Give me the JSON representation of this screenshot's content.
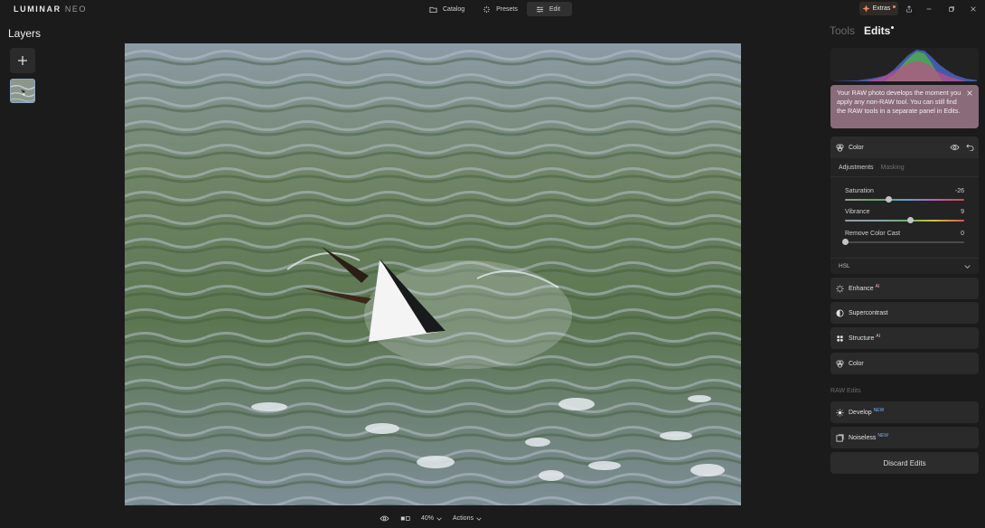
{
  "app": {
    "logo_main": "LUMINAR",
    "logo_sub": "NEO"
  },
  "nav": {
    "tabs": [
      {
        "label": "Catalog",
        "icon": "folder-icon"
      },
      {
        "label": "Presets",
        "icon": "sparkle-icon"
      },
      {
        "label": "Edit",
        "icon": "sliders-icon",
        "active": true
      }
    ]
  },
  "extras": {
    "label": "Extras",
    "icon": "extras-icon",
    "accent": "#f08a5d"
  },
  "layers": {
    "title": "Layers",
    "add_icon": "plus-icon",
    "thumb_icon": "layer-thumbnail"
  },
  "bottombar": {
    "zoom": "40%",
    "actions": "Actions",
    "eye_icon": "eye-icon",
    "compare_icon": "compare-icon"
  },
  "rightpanel": {
    "tabs": [
      {
        "label": "Tools",
        "active": false
      },
      {
        "label": "Edits",
        "active": true
      }
    ],
    "tooltip": "Your RAW photo develops the moment you apply any non-RAW tool. You can still find the RAW tools in a separate panel in Edits.",
    "tooltip_color": "#8a6b79",
    "color_tool": {
      "title": "Color",
      "subtabs": [
        {
          "label": "Adjustments",
          "active": true
        },
        {
          "label": "Masking",
          "active": false
        }
      ],
      "sliders": [
        {
          "label": "Saturation",
          "value": "-26",
          "position": 0.37
        },
        {
          "label": "Vibrance",
          "value": "9",
          "position": 0.55
        },
        {
          "label": "Remove Color Cast",
          "value": "0",
          "position": 0.0
        }
      ],
      "hsl_label": "HSL"
    },
    "edit_tools": [
      {
        "label": "Enhance",
        "icon": "enhance-icon",
        "badge": "AI"
      },
      {
        "label": "Supercontrast",
        "icon": "contrast-icon",
        "badge": ""
      },
      {
        "label": "Structure",
        "icon": "structure-icon",
        "badge": "AI"
      },
      {
        "label": "Color",
        "icon": "color-icon",
        "badge": ""
      }
    ],
    "raw_title": "RAW Edits",
    "raw_tools": [
      {
        "label": "Develop",
        "icon": "sun-icon",
        "badge": "NEW"
      },
      {
        "label": "Noiseless",
        "icon": "noiseless-icon",
        "badge": "NEW"
      }
    ],
    "discard_label": "Discard Edits"
  }
}
